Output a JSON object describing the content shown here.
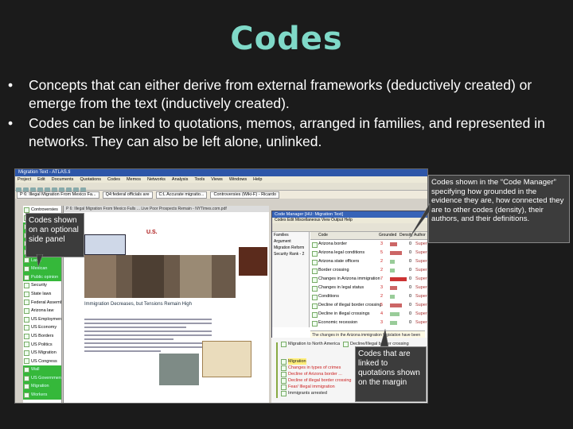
{
  "slide": {
    "title": "Codes",
    "bullets": [
      "Concepts that can either derive from external frameworks (deductively created) or emerge from the text (inductively created).",
      "Codes can be linked to quotations, memos, arranged in families, and represented in networks. They can also be left alone, unlinked."
    ],
    "bullet_symbol": "•"
  },
  "callouts": {
    "side_panel": "Codes shown on an optional side panel",
    "code_manager": "Codes shown in the “Code Manager” specifying how grounded in the evidence they are, how connected they are to other codes (density), their authors, and their definitions.",
    "margin": "Codes that are linked to quotations shown on the margin"
  },
  "screenshot": {
    "window_title": "Migration Text - ATLAS.ti",
    "menu": [
      "Project",
      "Edit",
      "Documents",
      "Quotations",
      "Codes",
      "Memos",
      "Networks",
      "Analysis",
      "Tools",
      "Views",
      "Windows",
      "Help"
    ],
    "doc_selectors": [
      "P 6: Illegal Migration From Mexico Fa...",
      "Q4:federal officials are",
      "C:L Accurate migratio...",
      "Controversies (Wiki-F) - Ricardo"
    ],
    "web_url": "P 6: Illegal Migration From Mexico Falls ... Live Poor Prospects Remain - NYTimes.com.pdf",
    "web_section": "U.S.",
    "web_headline": "Immigration Decreases, but Tensions Remain High",
    "side_codes": [
      "Controversies",
      "Dean Dibb...",
      "Border patrol...",
      "Federal agents",
      "Federal officials",
      "Illegal immigr...",
      "Lax...",
      "Mexican",
      "Public opinion",
      "Security",
      "State laws",
      "Federal Assembly",
      "Arizona law",
      "US Employment",
      "US Economy",
      "US Borders",
      "US Politics",
      "US Migration",
      "US Congress",
      "Wall",
      "US Government",
      "Migration",
      "Workers"
    ],
    "code_manager": {
      "title": "Code Manager [HU: Migration Text]",
      "menu": "Codes  Edit  Miscellaneous  View  Output  Help",
      "left_items": [
        "Families",
        "Argument",
        "Migration Reform",
        "Security Rank - 2"
      ],
      "columns": [
        "Code",
        "Grounded",
        "Density",
        "Author"
      ],
      "rows": [
        {
          "name": "Arizona border",
          "grounded": "3",
          "density": "0",
          "author": "Super",
          "bar": "#c66"
        },
        {
          "name": "Arizona legal conditions",
          "grounded": "5",
          "density": "0",
          "author": "Super",
          "bar": "#c66"
        },
        {
          "name": "Arizona state officers",
          "grounded": "2",
          "density": "0",
          "author": "Super",
          "bar": "#9c9"
        },
        {
          "name": "Border crossing",
          "grounded": "2",
          "density": "0",
          "author": "Super",
          "bar": "#9c9"
        },
        {
          "name": "Changes in Arizona immigration",
          "grounded": "7",
          "density": "0",
          "author": "Super",
          "bar": "#c33"
        },
        {
          "name": "Changes in legal status",
          "grounded": "3",
          "density": "0",
          "author": "Super",
          "bar": "#c66"
        },
        {
          "name": "Conditions",
          "grounded": "2",
          "density": "0",
          "author": "Super",
          "bar": "#9c9"
        },
        {
          "name": "Decline of illegal border crossing",
          "grounded": "5",
          "density": "0",
          "author": "Super",
          "bar": "#c66"
        },
        {
          "name": "Decline in illegal crossings",
          "grounded": "4",
          "density": "0",
          "author": "Super",
          "bar": "#9c9"
        },
        {
          "name": "Economic recession",
          "grounded": "3",
          "density": "0",
          "author": "Super",
          "bar": "#9c9"
        }
      ],
      "comment": "The changes in the Arizona immigration legislation have been reflected differently by the media."
    },
    "margin_codes": [
      "Migration to North America",
      "Decline/Illegal border crossing",
      "Migration",
      "Changes in types of crimes",
      "Decline of Arizona border ...",
      "Decline of illegal border crossing",
      "Fear/ Illegal immigration",
      "Immigrants arrested"
    ]
  }
}
